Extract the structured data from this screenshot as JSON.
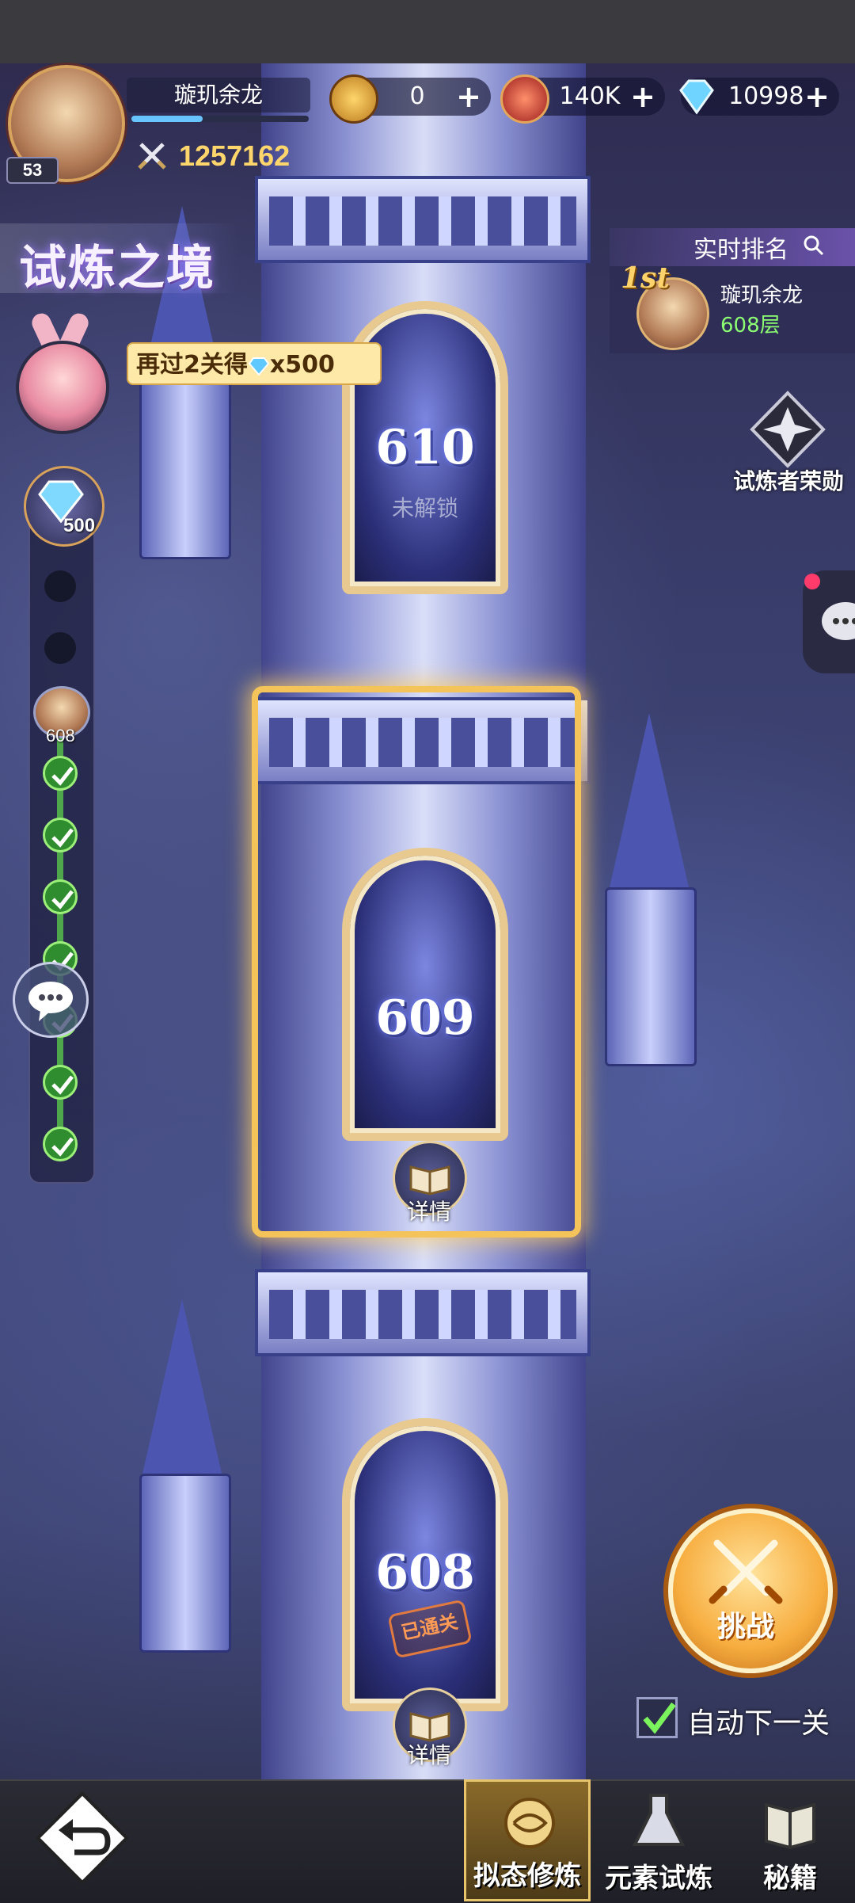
{
  "player": {
    "name": "璇玑余龙",
    "level": "53",
    "power": "1257162",
    "xp_fraction": 0.4
  },
  "currencies": [
    {
      "icon": "gold-coin-icon",
      "value": "0",
      "plus": "+"
    },
    {
      "icon": "red-orb-icon",
      "value": "140K",
      "plus": "+"
    },
    {
      "icon": "diamond-icon",
      "value": "10998",
      "plus": "+"
    }
  ],
  "title": "试炼之境",
  "ranking": {
    "title": "实时排名",
    "place": "1st",
    "name": "璇玑余龙",
    "floor": "608层"
  },
  "honor": {
    "label": "试炼者荣勋"
  },
  "reward_tip": {
    "prefix": "再过2关得",
    "amount": "x500"
  },
  "progress": {
    "gem_reward": "500",
    "current_floor": "608"
  },
  "floors": [
    {
      "number": "610",
      "status": "未解锁"
    },
    {
      "number": "609",
      "detail": "详情"
    },
    {
      "number": "608",
      "stamp": "已通关",
      "detail": "详情"
    }
  ],
  "challenge": {
    "label": "挑战"
  },
  "auto_next": {
    "label": "自动下一关",
    "checked": true
  },
  "nav": [
    {
      "label": "拟态修炼",
      "active": true
    },
    {
      "label": "元素试炼",
      "active": false
    },
    {
      "label": "秘籍",
      "active": false
    }
  ],
  "colors": {
    "accent_gold": "#f4c35a",
    "check_green": "#2f8d2f",
    "floor_text": "#8dff72"
  }
}
